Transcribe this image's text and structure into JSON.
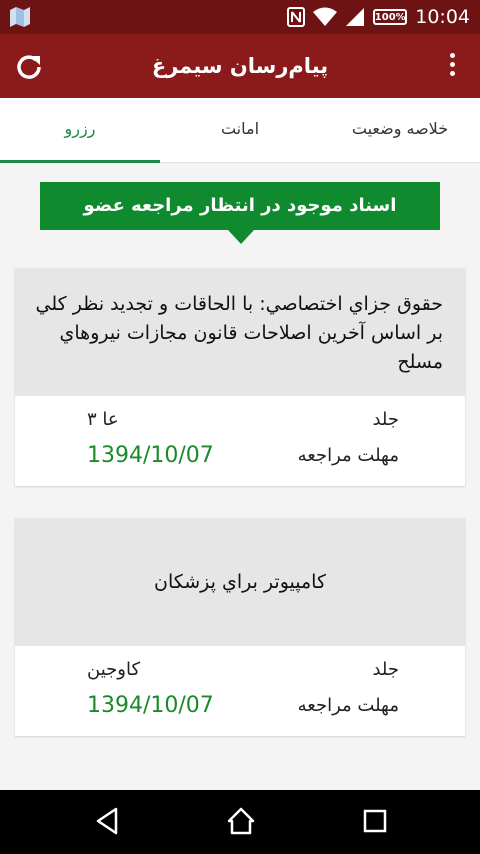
{
  "status_bar": {
    "time": "10:04",
    "battery": "100%",
    "icons": [
      "gallery-icon",
      "nfc-icon",
      "wifi-icon",
      "signal-icon",
      "battery-icon"
    ]
  },
  "app_bar": {
    "title": "پیام‌رسان سیمرغ",
    "refresh_icon": "refresh-icon",
    "menu_icon": "more-vert-icon"
  },
  "tabs": [
    {
      "label": "خلاصه وضعيت",
      "active": false
    },
    {
      "label": "امانت",
      "active": false
    },
    {
      "label": "رزرو",
      "active": true
    }
  ],
  "banner": "اسناد موجود در انتظار مراجعه عضو",
  "cards": [
    {
      "title": "حقوق جزاي اختصاصي: با الحاقات و تجديد نظر كلي بر اساس آخرين اصلاحات قانون مجازات نيروهاي مسلح",
      "volume_label": "جلد",
      "volume_value": "عا ۳",
      "deadline_label": "مهلت مراجعه",
      "deadline_value": "1394/10/07"
    },
    {
      "title": "كامپيوتر براي پزشكان",
      "volume_label": "جلد",
      "volume_value": "كاوجين",
      "deadline_label": "مهلت مراجعه",
      "deadline_value": "1394/10/07"
    }
  ],
  "colors": {
    "status_bar": "#6e1313",
    "app_bar": "#8b1a1a",
    "accent_green": "#1a8a4a",
    "banner_green": "#0f8a2e",
    "date_green": "#1a8a2a"
  },
  "nav_bar": {
    "back_icon": "back-triangle-icon",
    "home_icon": "home-icon",
    "recents_icon": "recents-square-icon"
  }
}
